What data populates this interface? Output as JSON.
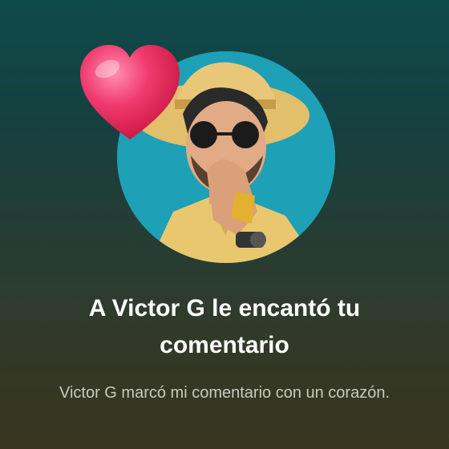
{
  "notification": {
    "title": "A Victor G le encantó tu comentario",
    "subtitle": "Victor G marcó mi comentario con un corazón."
  },
  "icons": {
    "avatar": "profile-illustration",
    "reaction": "heart-icon"
  },
  "colors": {
    "heart": "#e8245c",
    "avatar_bg": "#1ea0b6",
    "title_text": "#ffffff",
    "subtitle_text": "#c9c9c0"
  }
}
